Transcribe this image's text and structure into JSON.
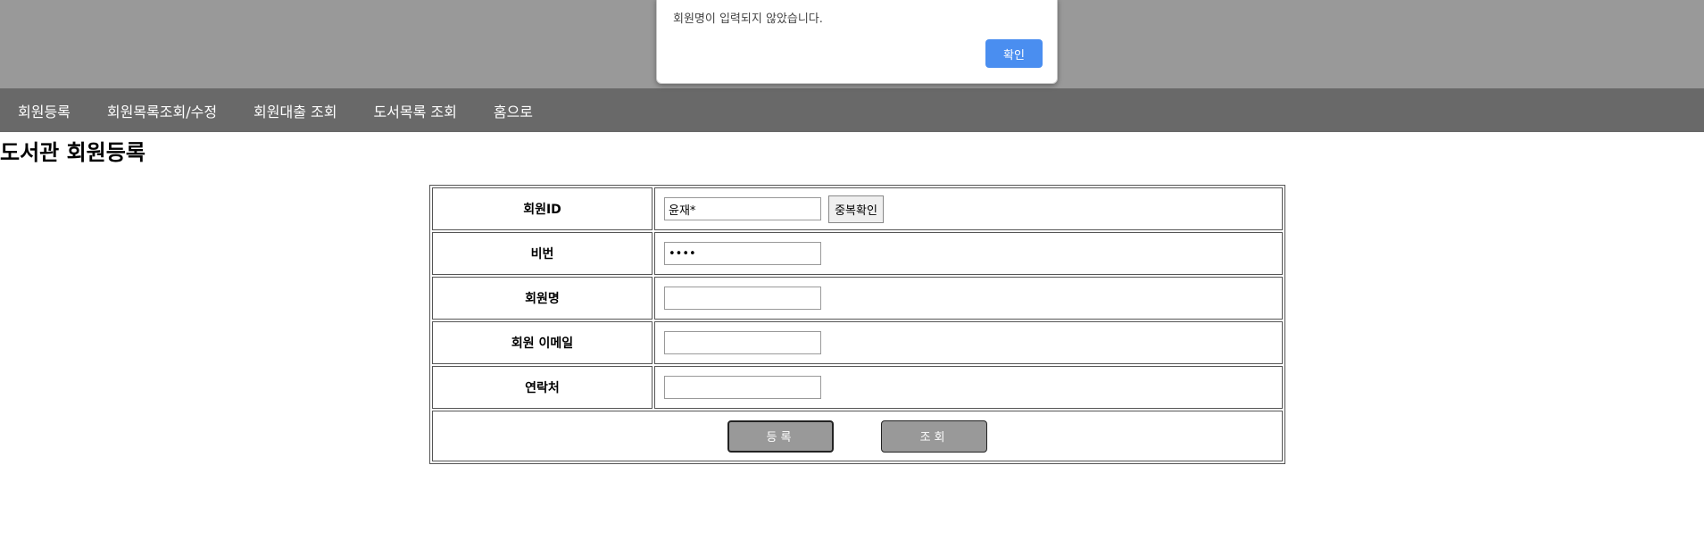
{
  "alert": {
    "message": "회원명이 입력되지 않았습니다.",
    "ok_label": "확인"
  },
  "nav": {
    "items": [
      {
        "label": "회원등록"
      },
      {
        "label": "회원목록조회/수정"
      },
      {
        "label": "회원대출 조회"
      },
      {
        "label": "도서목록 조회"
      },
      {
        "label": "홈으로"
      }
    ]
  },
  "page": {
    "title": "도서관 회원등록"
  },
  "form": {
    "id_label": "회원ID",
    "id_value": "윤재*",
    "dup_check_label": "중복확인",
    "pw_label": "비번",
    "pw_value": "1234",
    "name_label": "회원명",
    "name_value": "",
    "email_label": "회원 이메일",
    "email_value": "",
    "phone_label": "연락처",
    "phone_value": "",
    "register_label": "등록",
    "lookup_label": "조회"
  },
  "colors": {
    "nav_bg": "#696969",
    "overlay_bg": "#999999",
    "button_bg": "#999999",
    "alert_ok_bg": "#4a8ef0"
  }
}
